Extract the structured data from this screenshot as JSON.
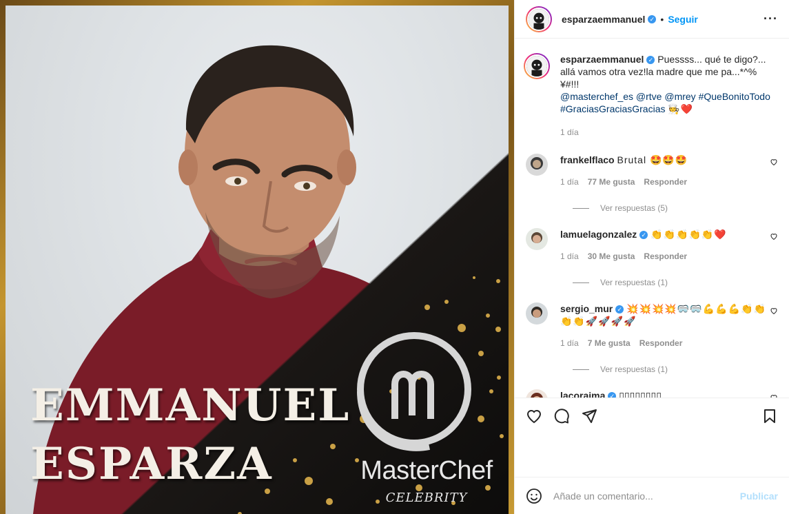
{
  "post": {
    "image": {
      "title_line1": "EMMANUEL",
      "title_line2": "ESPARZA",
      "brand": "MasterChef",
      "brand_sub": "CELEBRITY"
    },
    "header": {
      "username": "esparzaemmanuel",
      "separator": "•",
      "follow_label": "Seguir",
      "more_label": "···"
    },
    "caption": {
      "username": "esparzaemmanuel",
      "text": "Puessss... qué te digo?... allá vamos otra vez!la madre que me pa...*^%¥#!!!",
      "mentions": "@masterchef_es @rtve @mrey #QueBonitoTodo #GraciasGraciasGracias",
      "emojis": "🧑‍🍳❤️",
      "time": "1 día"
    },
    "comments": [
      {
        "username": "frankelflaco",
        "text": "Brutal 🤩🤩🤩",
        "time": "1 día",
        "likes": "77 Me gusta",
        "reply": "Responder",
        "replies": "Ver respuestas (5)"
      },
      {
        "username": "lamuelagonzalez",
        "text": "👏👏👏👏👏❤️",
        "time": "1 día",
        "likes": "30 Me gusta",
        "reply": "Responder",
        "replies": "Ver respuestas (1)"
      },
      {
        "username": "sergio_mur",
        "text": "💥💥💥💥🥽🥽💪💪💪👏👏👏👏🚀🚀🚀🚀",
        "time": "1 día",
        "likes": "7 Me gusta",
        "reply": "Responder",
        "replies": "Ver respuestas (1)"
      },
      {
        "username": "lacoraima",
        "text": "▯▯▯▯▯▯▯▯"
      }
    ],
    "composer": {
      "placeholder": "Añade un comentario...",
      "publish_label": "Publicar"
    },
    "colors": {
      "link": "#00376b",
      "follow": "#0095f6",
      "verified": "#3897f0",
      "heart": "#ed4956"
    }
  }
}
